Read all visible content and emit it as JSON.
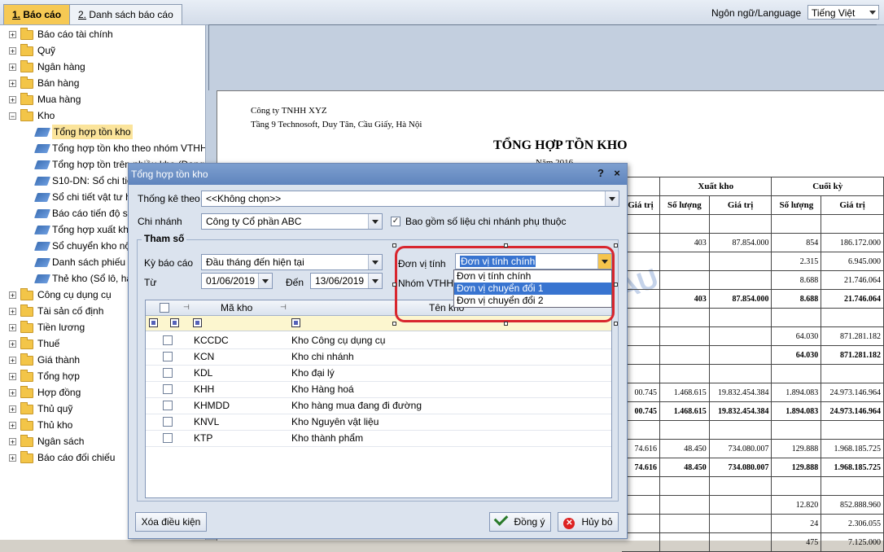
{
  "tabs": [
    {
      "num": "1.",
      "label": " Báo cáo"
    },
    {
      "num": "2.",
      "label": " Danh sách báo cáo"
    }
  ],
  "language": {
    "label": "Ngôn ngữ/Language",
    "value": "Tiếng Việt"
  },
  "tree": {
    "items": [
      "Báo cáo tài chính",
      "Quỹ",
      "Ngân hàng",
      "Bán hàng",
      "Mua hàng",
      "Kho",
      "Tổng hợp tồn kho",
      "Tổng hợp tồn kho theo nhóm VTHH",
      "Tổng hợp tồn trên nhiều kho (Dạng",
      "S10-DN: Sổ chi tiết vật liệu",
      "Sổ chi tiết vật tư hàng hoá",
      "Báo cáo tiến độ sản xuất",
      "Tổng hợp xuất kho",
      "Sổ chuyển kho nội bộ",
      "Danh sách phiếu xuất",
      "Thẻ kho (Sổ lô, hạn",
      "Công cụ dụng cụ",
      "Tài sản cố định",
      "Tiền lương",
      "Thuế",
      "Giá thành",
      "Tổng hợp",
      "Hợp đồng",
      "Thủ quỹ",
      "Thủ kho",
      "Ngân sách",
      "Báo cáo đối chiếu"
    ]
  },
  "report": {
    "company": "Công ty TNHH XYZ",
    "address": "Tầng 9 Technosoft, Duy Tân, Cầu Giấy, Hà Nội",
    "title": "TỔNG HỢP TỒN KHO",
    "subtitle": "Năm 2016",
    "watermark": "AU",
    "group_headers": [
      "Xuất kho",
      "Cuối kỳ"
    ],
    "col_headers": [
      "Giá trị",
      "Số lượng",
      "Giá trị",
      "Số lượng",
      "Giá trị"
    ],
    "rows": [
      [
        "",
        "",
        "",
        "",
        ""
      ],
      [
        "",
        "403",
        "87.854.000",
        "854",
        "186.172.000"
      ],
      [
        "",
        "",
        "",
        "2.315",
        "6.945.000"
      ],
      [
        "",
        "",
        "",
        "8.688",
        "21.746.064"
      ],
      [
        "",
        "403",
        "87.854.000",
        "8.688",
        "21.746.064"
      ],
      [
        "",
        "",
        "",
        "",
        ""
      ],
      [
        "",
        "",
        "",
        "64.030",
        "871.281.182"
      ],
      [
        "",
        "",
        "",
        "64.030",
        "871.281.182"
      ],
      [
        "",
        "",
        "",
        "",
        ""
      ],
      [
        "00.745",
        "1.468.615",
        "19.832.454.384",
        "1.894.083",
        "24.973.146.964"
      ],
      [
        "00.745",
        "1.468.615",
        "19.832.454.384",
        "1.894.083",
        "24.973.146.964"
      ],
      [
        "",
        "",
        "",
        "",
        ""
      ],
      [
        "74.616",
        "48.450",
        "734.080.007",
        "129.888",
        "1.968.185.725"
      ],
      [
        "74.616",
        "48.450",
        "734.080.007",
        "129.888",
        "1.968.185.725"
      ],
      [
        "",
        "",
        "",
        "",
        ""
      ],
      [
        "",
        "",
        "",
        "12.820",
        "852.888.960"
      ],
      [
        "",
        "",
        "",
        "24",
        "2.306.055"
      ],
      [
        "",
        "",
        "",
        "475",
        "7.125.000"
      ]
    ]
  },
  "dialog": {
    "title": "Tổng hợp tồn kho",
    "help": "?",
    "close": "×",
    "thong_ke_label": "Thống kê theo",
    "thong_ke_value": "<<Không chọn>>",
    "chi_nhanh_label": "Chi nhánh",
    "chi_nhanh_value": "Công ty Cổ phần ABC",
    "bao_gom_label": "Bao gồm số liệu chi nhánh phụ thuộc",
    "group_title": "Tham số",
    "ky_bao_cao_label": "Kỳ báo cáo",
    "ky_bao_cao_value": "Đầu tháng đến hiện tại",
    "tu_label": "Từ",
    "tu_value": "01/06/2019",
    "den_label": "Đến",
    "den_value": "13/06/2019",
    "don_vi_label": "Đơn vị tính",
    "don_vi_value": "Đơn vị tính chính",
    "nhom_label": "Nhóm VTHH",
    "don_vi_options": [
      "Đơn vị tính chính",
      "Đơn vị chuyển đổi 1",
      "Đơn vị chuyển đổi 2"
    ],
    "grid_headers": [
      "Mã kho",
      "Tên kho"
    ],
    "grid_rows": [
      [
        "KCCDC",
        "Kho Công cụ dụng cụ"
      ],
      [
        "KCN",
        "Kho chi nhánh"
      ],
      [
        "KDL",
        "Kho đại lý"
      ],
      [
        "KHH",
        "Kho Hàng hoá"
      ],
      [
        "KHMDD",
        "Kho hàng mua đang đi đường"
      ],
      [
        "KNVL",
        "Kho Nguyên vật liệu"
      ],
      [
        "KTP",
        "Kho thành phẩm"
      ]
    ],
    "clear_button": "Xóa điều kiện",
    "ok_button": "Đồng ý",
    "cancel_button": "Hủy bỏ"
  }
}
